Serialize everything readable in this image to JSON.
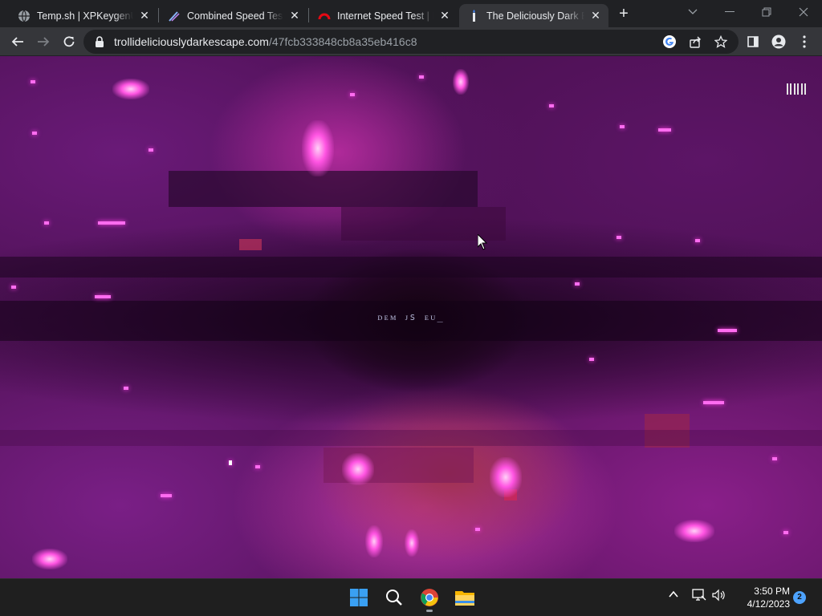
{
  "browser": {
    "tabs": [
      {
        "title": "Temp.sh | XPKeygenUL",
        "favicon": "globe-icon",
        "active": false
      },
      {
        "title": "Combined Speed Test f",
        "favicon": "speed-test-icon",
        "active": false
      },
      {
        "title": "Internet Speed Test | Fa",
        "favicon": "fast-icon",
        "active": false
      },
      {
        "title": "The Deliciously Dark Es",
        "favicon": "candle-icon",
        "active": true
      }
    ],
    "new_tab_symbol": "+",
    "close_symbol": "✕",
    "address": {
      "domain": "trollideliciouslydarkescape.com",
      "path": "/47fcb333848cb8a35eb416c8"
    }
  },
  "page": {
    "center_text": "ᴅᴇᴍ ᴊs ᴇᴜ_",
    "menu_icon": "bars-menu-icon",
    "colors": {
      "base": "#4a1050",
      "spark": "#ff6cf0",
      "glow": "#ff54e2"
    }
  },
  "taskbar": {
    "apps": [
      "windows-start-icon",
      "search-icon",
      "chrome-icon",
      "file-explorer-icon"
    ],
    "time": "3:50 PM",
    "date": "4/12/2023",
    "notification_count": "2"
  }
}
